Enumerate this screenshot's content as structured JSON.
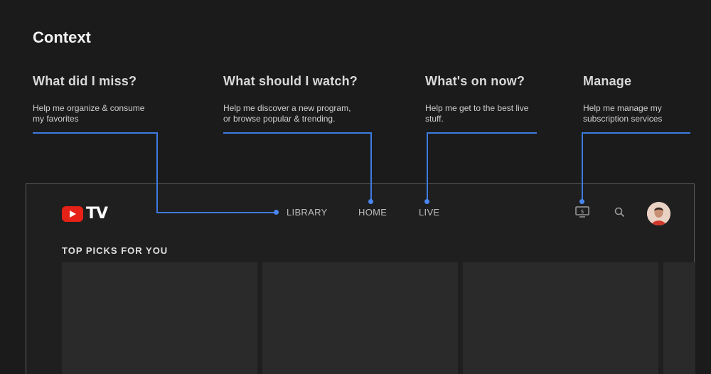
{
  "section_title": "Context",
  "contexts": [
    {
      "heading": "What did I miss?",
      "desc_line1": "Help me organize & consume",
      "desc_line2": "my favorites"
    },
    {
      "heading": "What should I watch?",
      "desc_line1": "Help me discover a new program,",
      "desc_line2": "or browse popular & trending."
    },
    {
      "heading": "What's on now?",
      "desc_line1": "Help me get to the best live",
      "desc_line2": "stuff."
    },
    {
      "heading": "Manage",
      "desc_line1": "Help me manage my",
      "desc_line2": "subscription services"
    }
  ],
  "tv": {
    "logo_text": "TV",
    "nav": {
      "library": "LIBRARY",
      "home": "HOME",
      "live": "LIVE"
    },
    "row_title": "TOP PICKS FOR YOU",
    "icons": {
      "manage": "tv-screen-icon",
      "search": "search-icon",
      "avatar": "user-avatar"
    }
  },
  "colors": {
    "accent_line": "#3d7be0",
    "brand_red": "#e62117",
    "background": "#1b1b1b"
  }
}
